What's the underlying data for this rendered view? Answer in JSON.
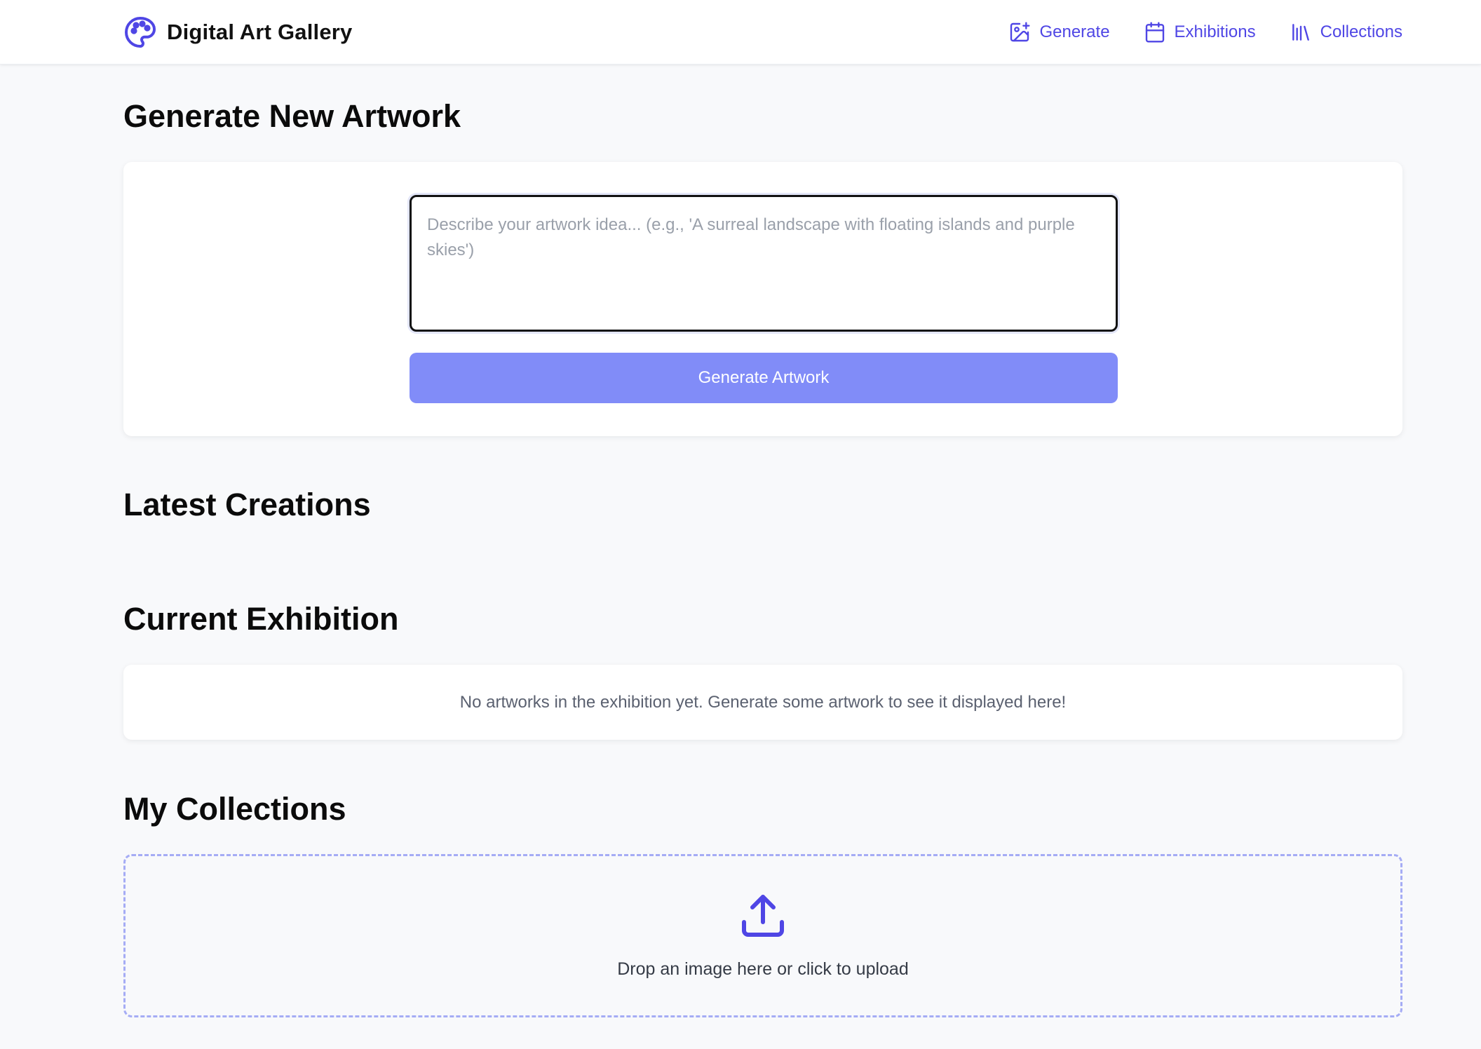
{
  "header": {
    "brand_title": "Digital Art Gallery",
    "nav": [
      {
        "label": "Generate",
        "icon": "image-plus-icon"
      },
      {
        "label": "Exhibitions",
        "icon": "calendar-icon"
      },
      {
        "label": "Collections",
        "icon": "library-icon"
      }
    ]
  },
  "generate": {
    "title": "Generate New Artwork",
    "prompt_placeholder": "Describe your artwork idea... (e.g., 'A surreal landscape with floating islands and purple skies')",
    "prompt_value": "",
    "button_label": "Generate Artwork"
  },
  "latest": {
    "title": "Latest Creations"
  },
  "exhibition": {
    "title": "Current Exhibition",
    "empty_message": "No artworks in the exhibition yet. Generate some artwork to see it displayed here!"
  },
  "collections": {
    "title": "My Collections",
    "upload_text": "Drop an image here or click to upload",
    "upload_icon": "upload-icon"
  },
  "colors": {
    "accent": "#4f46e5",
    "button": "#818cf8",
    "background": "#f8f9fb"
  }
}
